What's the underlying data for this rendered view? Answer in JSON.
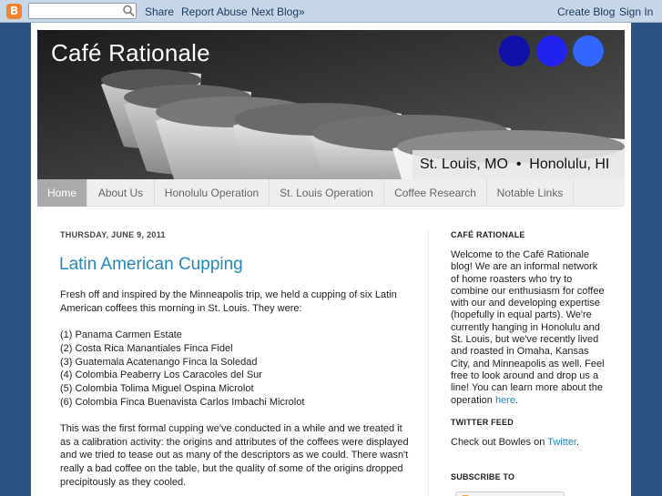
{
  "navbar": {
    "logo_letter": "B",
    "search_placeholder": "",
    "share": "Share",
    "report_abuse": "Report Abuse",
    "next_blog": "Next Blog»",
    "create_blog": "Create Blog",
    "sign_in": "Sign In"
  },
  "header": {
    "title": "Café Rationale",
    "location": "St. Louis, MO  •  Honolulu, HI",
    "dot_colors": [
      "#1111aa",
      "#2222ee",
      "#3366ff"
    ]
  },
  "tabs": [
    {
      "label": "Home",
      "active": true
    },
    {
      "label": "About Us",
      "active": false
    },
    {
      "label": "Honolulu Operation",
      "active": false
    },
    {
      "label": "St. Louis Operation",
      "active": false
    },
    {
      "label": "Coffee Research",
      "active": false
    },
    {
      "label": "Notable Links",
      "active": false
    }
  ],
  "post": {
    "date": "THURSDAY, JUNE 9, 2011",
    "title": "Latin American Cupping",
    "intro": "Fresh off and inspired by the Minneapolis trip, we held a cupping of six Latin American coffees this morning in St. Louis. They were:",
    "coffees": [
      "(1) Panama Carmen Estate",
      "(2) Costa Rica Manantiales Finca Fidel",
      "(3) Guatemala Acatenango Finca la Soledad",
      "(4) Colombia Peaberry Los Caracoles del Sur",
      "(5) Colombia Tolima Miguel Ospina Microlot",
      "(6) Colombia Finca Buenavista Carlos Imbachi Microlot"
    ],
    "paragraph2": "This was the first formal cupping we've conducted in a while and we treated it as a calibration activity: the origins and attributes of the coffees were displayed and we tried to tease out as many of the descriptors as we could. There wasn't really a bad coffee on the table, but the quality of some of the origins dropped precipitously as they cooled."
  },
  "sidebar": {
    "about_heading": "CAFÉ RATIONALE",
    "about_text": "Welcome to the Café Rationale blog! We are an informal network of home roasters who try to combine our enthusiasm for coffee with our and developing expertise (hopefully in equal parts). We're currently hanging in Honolulu and St. Louis, but we've recently lived and roasted in Omaha, Kansas City, and Minneapolis as well. Feel free to look around and drop us a line! You can learn more about the operation ",
    "about_link": "here",
    "about_end": ".",
    "twitter_heading": "TWITTER FEED",
    "twitter_text": "Check out Bowles on ",
    "twitter_link": "Twitter",
    "twitter_end": ".",
    "subscribe_heading": "SUBSCRIBE TO"
  },
  "colors": {
    "page_bg": "#2a5384",
    "link": "#2288bb",
    "active_tab": "#aaaaaa"
  }
}
